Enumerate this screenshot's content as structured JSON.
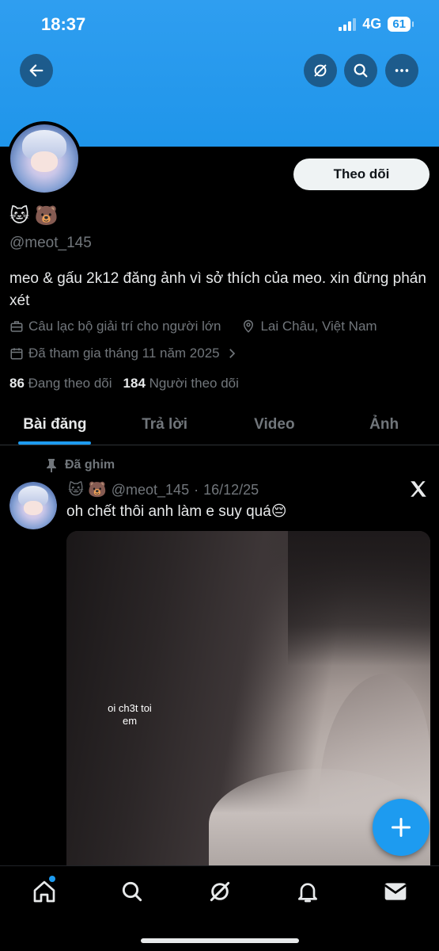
{
  "status_bar": {
    "time": "18:37",
    "network": "4G",
    "battery": "61"
  },
  "header": {
    "back_icon": "arrow-left-icon",
    "grok_icon": "grok-icon",
    "search_icon": "search-icon",
    "more_icon": "more-icon"
  },
  "profile": {
    "follow_label": "Theo dõi",
    "display_name": "🐱 🐻",
    "handle": "@meot_145",
    "bio": "meo & gấu 2k12 đăng ảnh vì sở thích của meo. xin đừng phán xét",
    "category": "Câu lạc bộ giải trí cho người lớn",
    "location": "Lai Châu, Việt Nam",
    "joined": "Đã tham gia tháng 11 năm 2025",
    "following_count": "86",
    "following_label": "Đang theo dõi",
    "followers_count": "184",
    "followers_label": "Người theo dõi"
  },
  "tabs": [
    {
      "label": "Bài đăng",
      "active": true
    },
    {
      "label": "Trả lời",
      "active": false
    },
    {
      "label": "Video",
      "active": false
    },
    {
      "label": "Ảnh",
      "active": false
    }
  ],
  "post": {
    "pinned_label": "Đã ghim",
    "author_emoji": "🐱 🐻",
    "handle": "@meot_145",
    "separator": "·",
    "date": "16/12/25",
    "text": "oh chết thôi anh làm e suy quá😔",
    "media_caption": "oi ch3t toi em"
  },
  "colors": {
    "accent": "#1d9bf0",
    "banner": "#1f95ea",
    "muted": "#71767b"
  },
  "bottom_nav": [
    "home-icon",
    "search-icon",
    "grok-icon",
    "notifications-icon",
    "messages-icon"
  ]
}
